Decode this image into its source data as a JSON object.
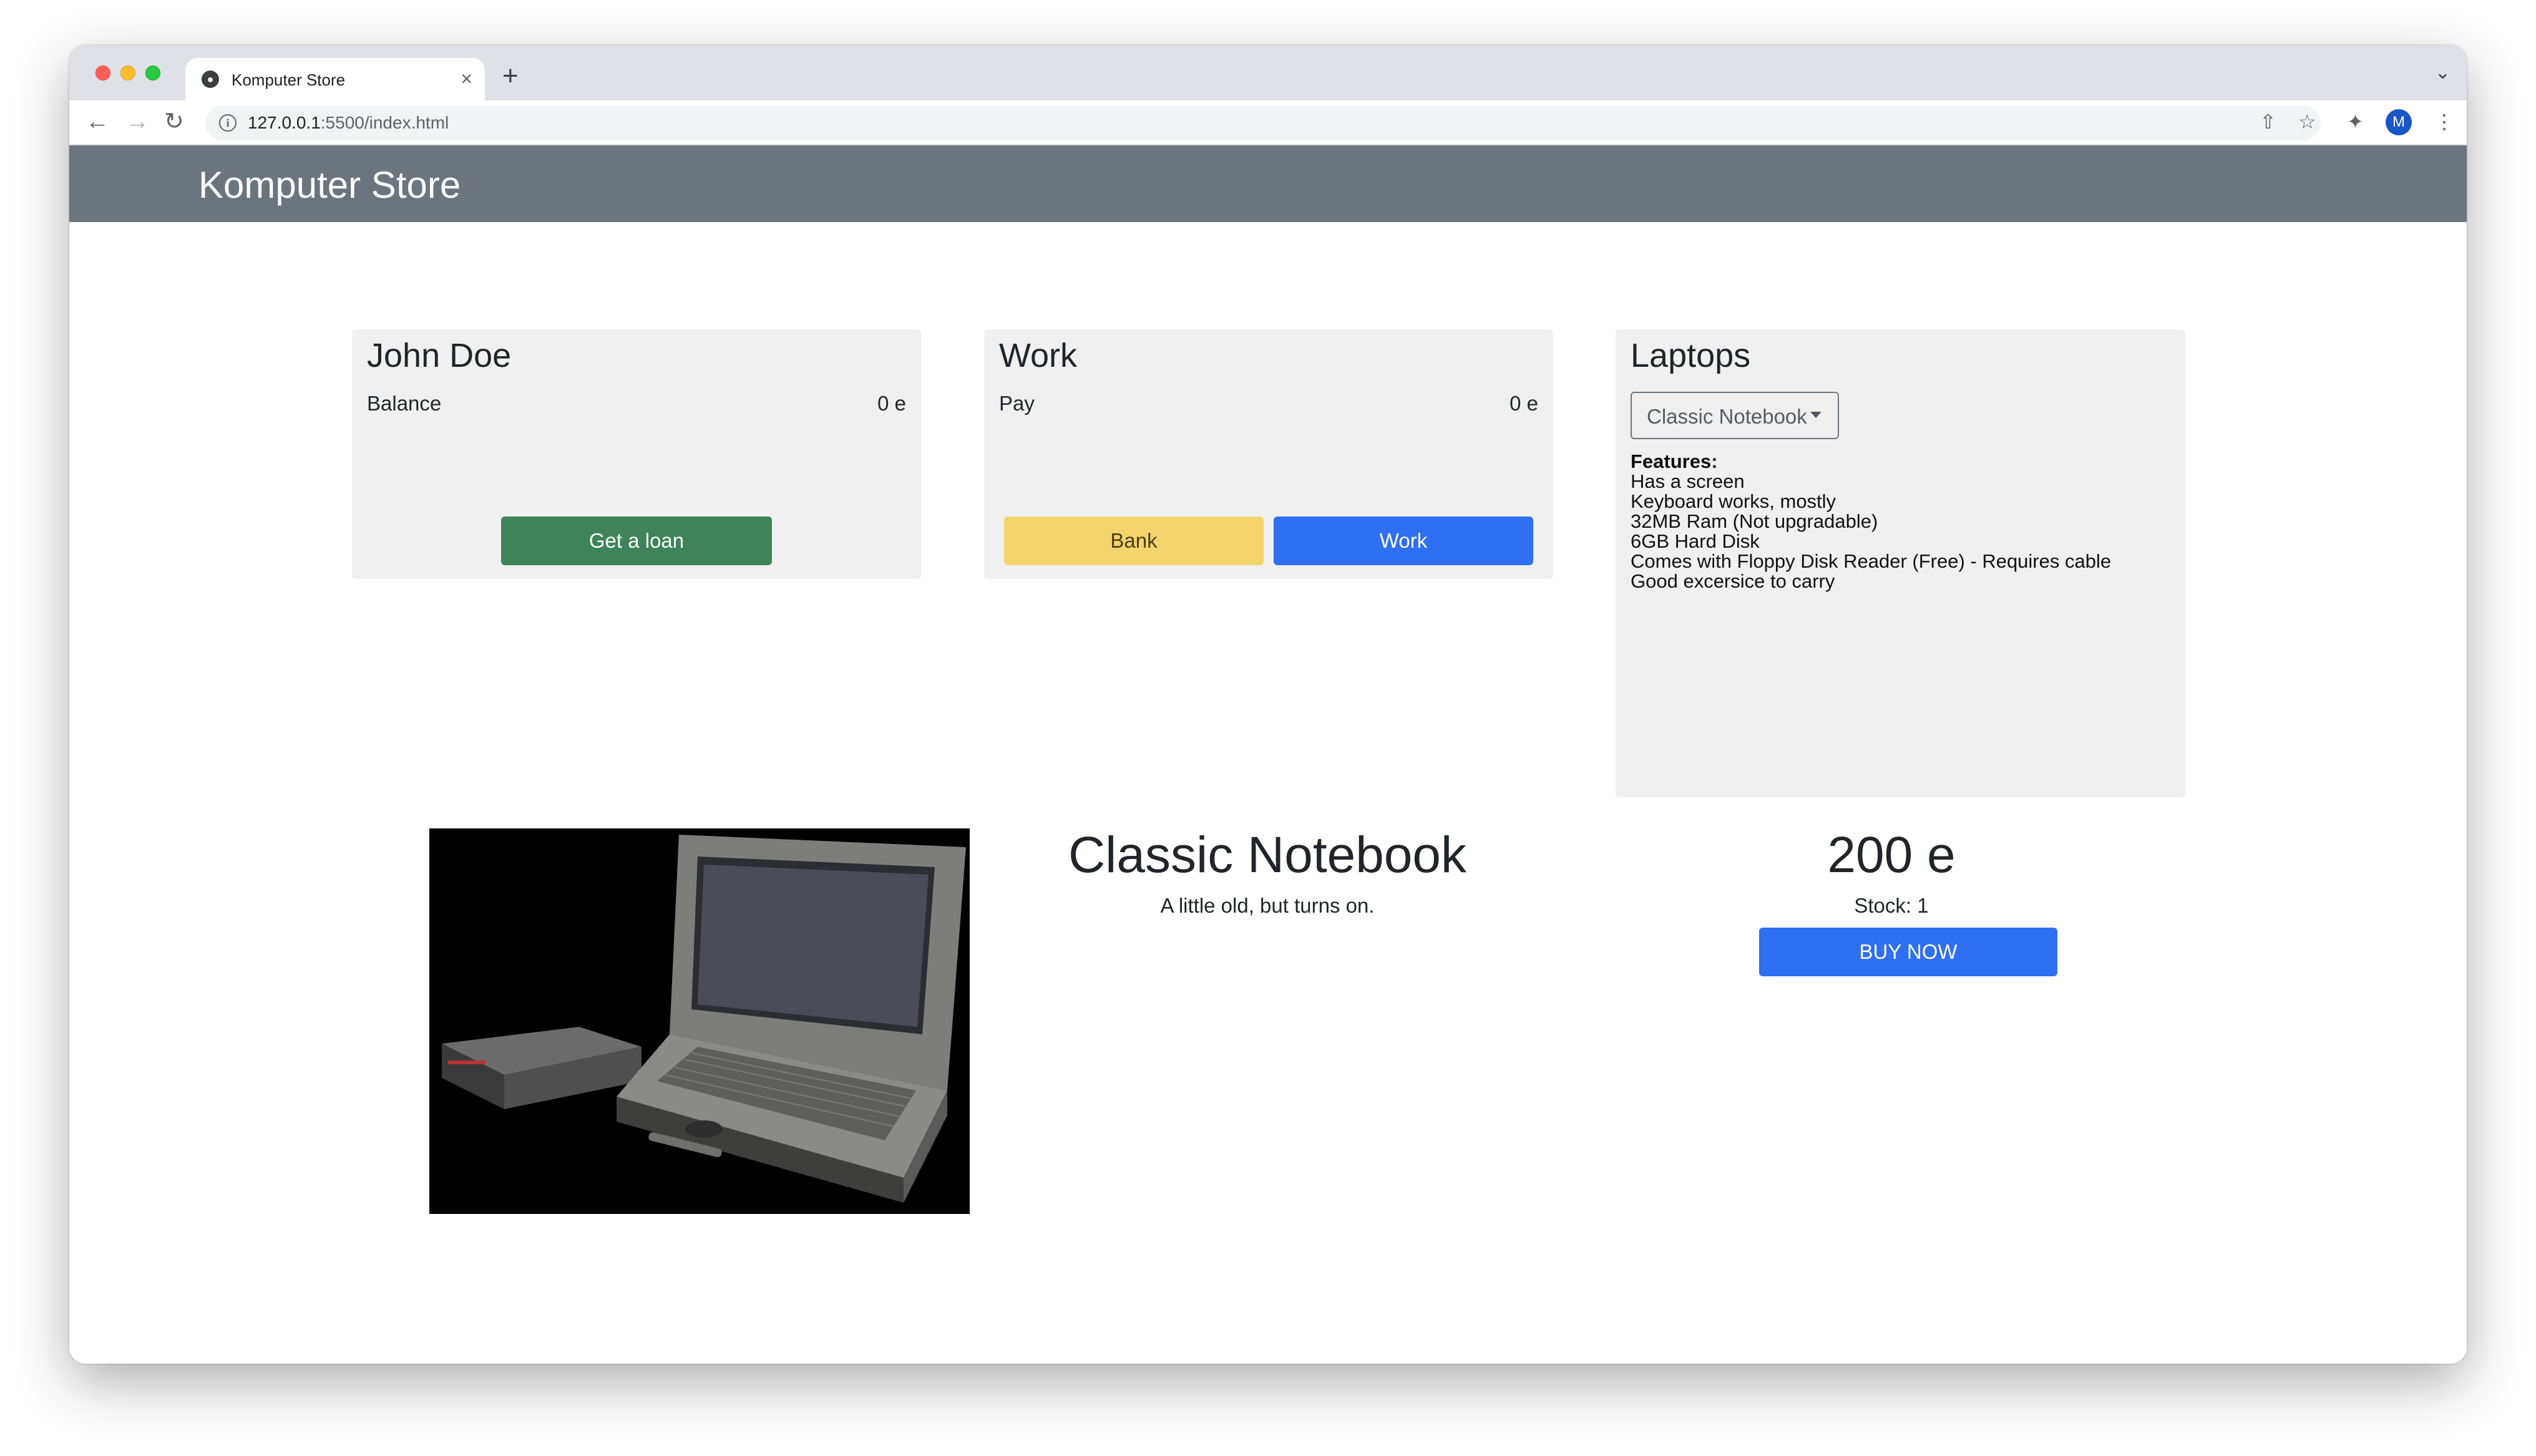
{
  "browser": {
    "tab_title": "Komputer Store",
    "url_host": "127.0.0.1",
    "url_rest": ":5500/index.html",
    "avatar_initial": "M"
  },
  "navbar": {
    "brand": "Komputer Store"
  },
  "bank": {
    "title": "John Doe",
    "balance_label": "Balance",
    "balance_value": "0 e",
    "loan_button": "Get a loan"
  },
  "work": {
    "title": "Work",
    "pay_label": "Pay",
    "pay_value": "0 e",
    "bank_button": "Bank",
    "work_button": "Work"
  },
  "laptops": {
    "title": "Laptops",
    "selected": "Classic Notebook",
    "features_heading": "Features:",
    "features": [
      "Has a screen",
      "Keyboard works, mostly",
      "32MB Ram (Not upgradable)",
      "6GB Hard Disk",
      "Comes with Floppy Disk Reader (Free) - Requires cable",
      "Good excersice to carry"
    ]
  },
  "product": {
    "name": "Classic Notebook",
    "description": "A little old, but turns on.",
    "price": "200 e",
    "stock": "Stock: 1",
    "buy_button": "BUY NOW"
  },
  "colors": {
    "navbar": "#6c757d",
    "loan_button": "#3e8458",
    "bank_button": "#f3d46d",
    "primary_button": "#2f6ff2",
    "card_background": "#f0f0f0"
  }
}
